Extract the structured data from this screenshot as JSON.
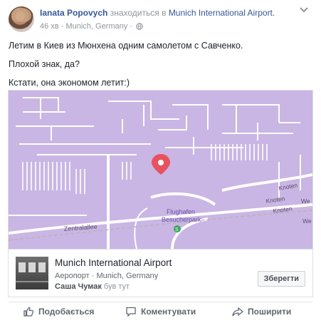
{
  "post": {
    "author": "Ianata Popovych",
    "location_prefix": "знаходиться в",
    "location": "Munich International Airport.",
    "time": "46 хв",
    "place_meta": "Munich, Germany",
    "privacy_icon": "globe-icon",
    "menu_icon": "chevron-down-icon",
    "lines": [
      "Летим в Киев из Мюнхена одним самолетом с Савченко.",
      "Плохой знак, да?",
      "Кстати, она экономом летит:)"
    ]
  },
  "map": {
    "labels": {
      "street_left": "Zentralallee",
      "poi_line1": "Flughafen",
      "poi_line2": "Besucherpark",
      "knoten_1": "Knoten",
      "knoten_2": "Knoten",
      "knoten_3": "Knoten",
      "we_1": "We",
      "we_2": "We"
    },
    "colors": {
      "background": "#c9b6e4",
      "roads": "#ffffff",
      "pin": "#e8525f"
    }
  },
  "place_card": {
    "name": "Munich International Airport",
    "category": "Аеропорт · Munich, Germany",
    "visitor": "Саша Чумак",
    "visitor_suffix": "був тут",
    "save_label": "Зберегти"
  },
  "actions": {
    "like": "Подобається",
    "comment": "Коментувати",
    "share": "Поширити"
  }
}
